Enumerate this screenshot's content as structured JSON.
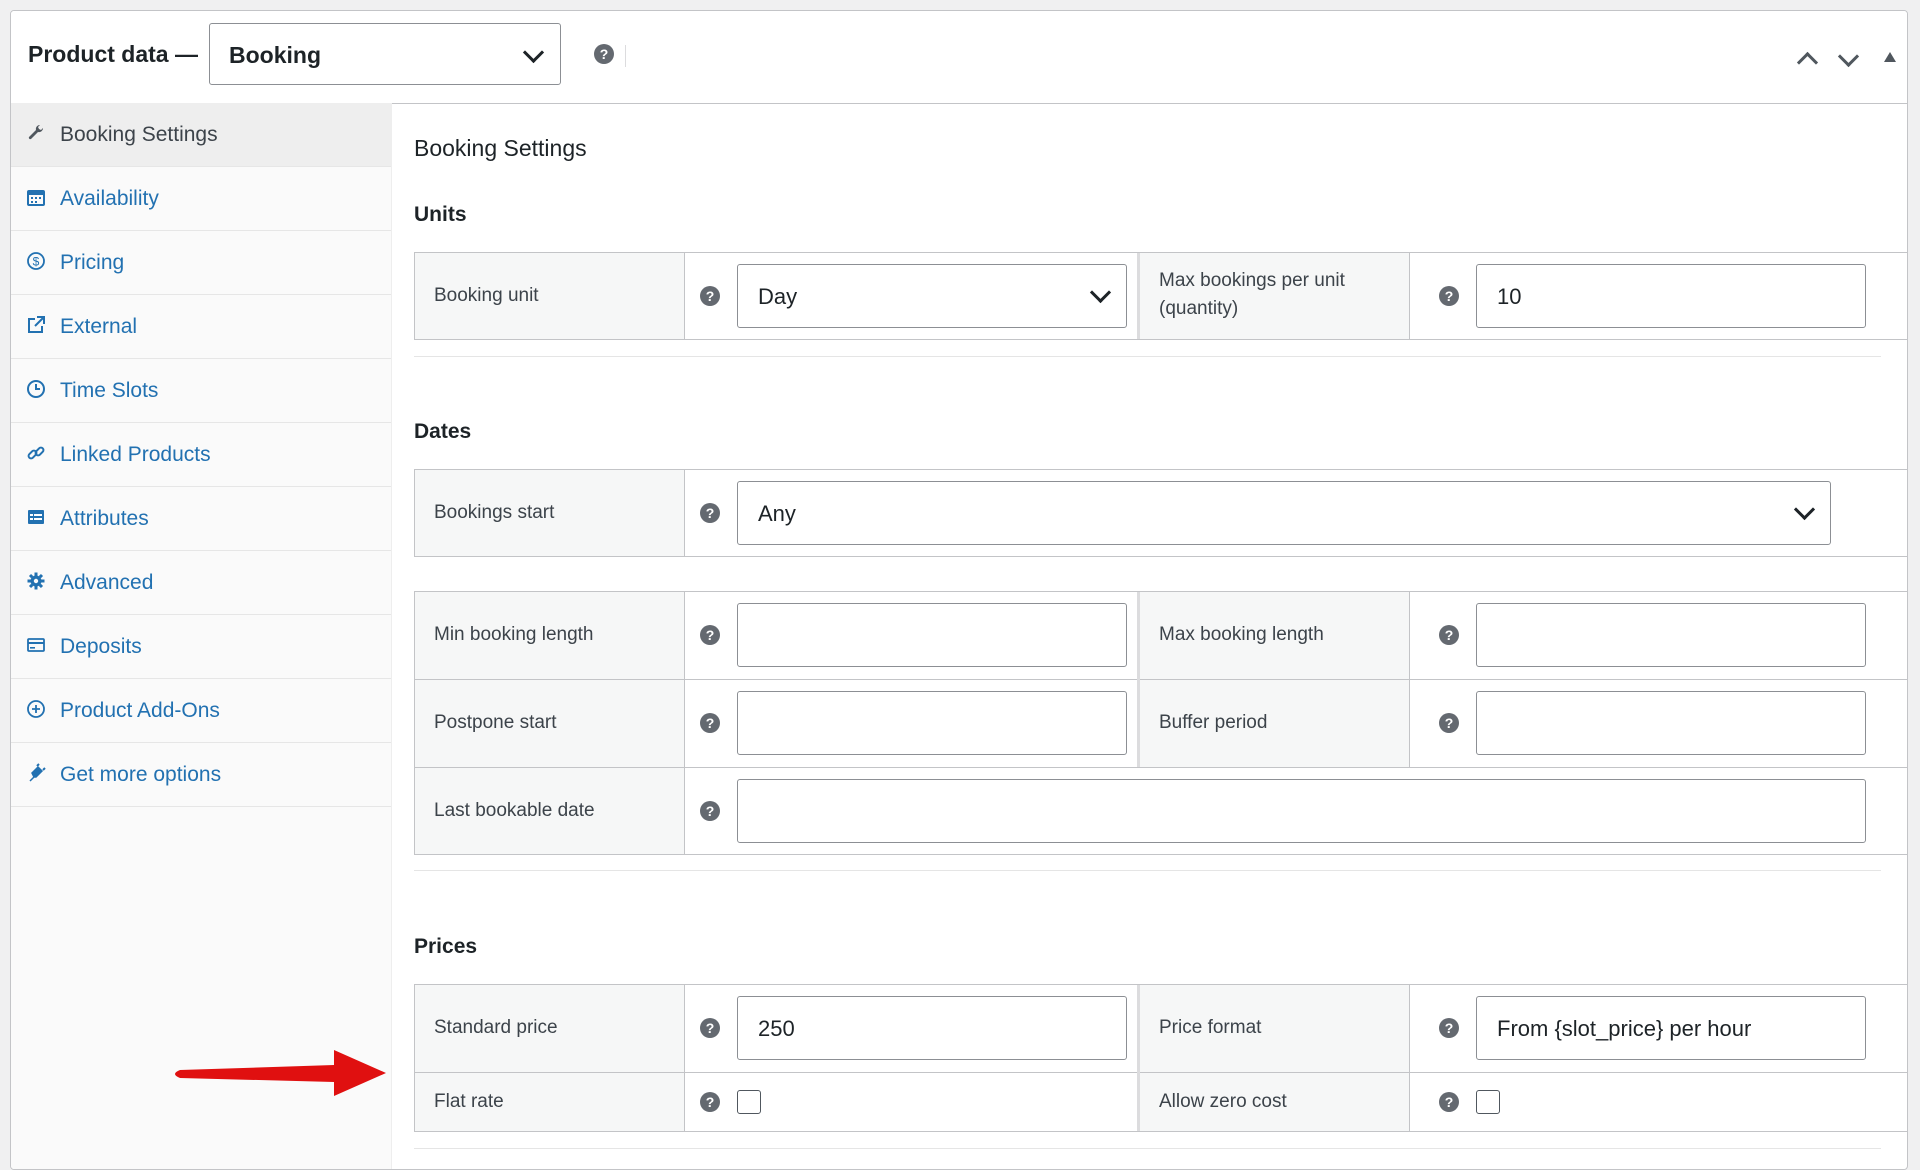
{
  "header": {
    "label": "Product data —",
    "product_type": "Booking",
    "help_glyph": "?"
  },
  "sidebar": {
    "items": [
      {
        "label": "Booking Settings",
        "icon": "wrench-icon",
        "active": true
      },
      {
        "label": "Availability",
        "icon": "calendar-icon"
      },
      {
        "label": "Pricing",
        "icon": "dollar-circle-icon"
      },
      {
        "label": "External",
        "icon": "external-link-icon"
      },
      {
        "label": "Time Slots",
        "icon": "clock-icon"
      },
      {
        "label": "Linked Products",
        "icon": "link-icon"
      },
      {
        "label": "Attributes",
        "icon": "list-table-icon"
      },
      {
        "label": "Advanced",
        "icon": "gear-icon"
      },
      {
        "label": "Deposits",
        "icon": "card-icon"
      },
      {
        "label": "Product Add-Ons",
        "icon": "plus-circle-icon"
      },
      {
        "label": "Get more options",
        "icon": "plugin-icon"
      }
    ]
  },
  "main": {
    "title": "Booking Settings",
    "units": {
      "heading": "Units",
      "booking_unit_label": "Booking unit",
      "booking_unit_value": "Day",
      "max_bookings_label_line1": "Max bookings per unit",
      "max_bookings_label_line2": "(quantity)",
      "max_bookings_value": "10"
    },
    "dates": {
      "heading": "Dates",
      "bookings_start_label": "Bookings start",
      "bookings_start_value": "Any",
      "min_length_label": "Min booking length",
      "min_length_value": "",
      "max_length_label": "Max booking length",
      "max_length_value": "",
      "postpone_label": "Postpone start",
      "postpone_value": "",
      "buffer_label": "Buffer period",
      "buffer_value": "",
      "last_date_label": "Last bookable date",
      "last_date_value": ""
    },
    "prices": {
      "heading": "Prices",
      "standard_label": "Standard price",
      "standard_value": "250",
      "format_label": "Price format",
      "format_value": "From {slot_price} per hour",
      "flat_rate_label": "Flat rate",
      "flat_rate_checked": false,
      "zero_cost_label": "Allow zero cost",
      "zero_cost_checked": false
    }
  },
  "colors": {
    "link": "#2271b1",
    "border": "#c3c4c7",
    "arrow": "#e01010"
  }
}
